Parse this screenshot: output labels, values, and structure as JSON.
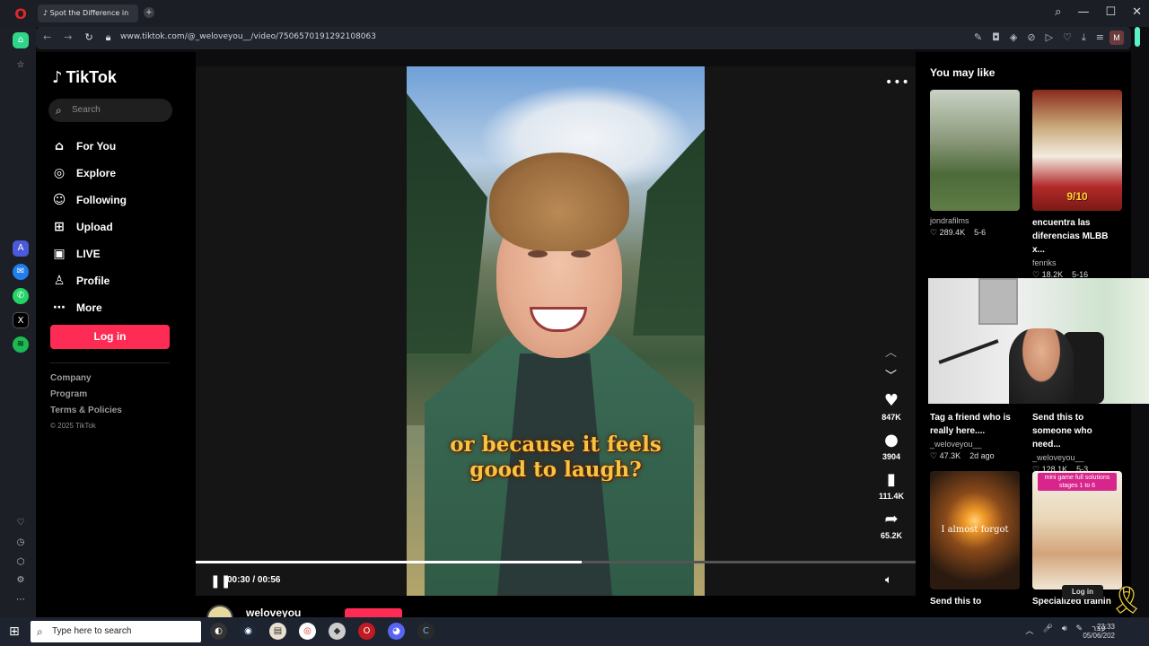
{
  "browser": {
    "tab_title": "Spot the Difference in",
    "new_tab": "+",
    "url": "www.tiktok.com/@_weloveyou__/video/7506570191292108063",
    "profile_initial": "M",
    "window_controls": [
      "⌕",
      "—",
      "☐",
      "✕"
    ]
  },
  "tiktok": {
    "brand": "TikTok",
    "search_placeholder": "Search",
    "nav": [
      {
        "label": "For You",
        "icon": "home-icon"
      },
      {
        "label": "Explore",
        "icon": "compass-icon"
      },
      {
        "label": "Following",
        "icon": "following-icon"
      },
      {
        "label": "Upload",
        "icon": "upload-icon"
      },
      {
        "label": "LIVE",
        "icon": "live-icon"
      },
      {
        "label": "Profile",
        "icon": "profile-icon"
      },
      {
        "label": "More",
        "icon": "more-icon"
      }
    ],
    "login": "Log in",
    "footer": {
      "company": "Company",
      "program": "Program",
      "terms": "Terms & Policies",
      "copyright": "© 2025 TikTok"
    }
  },
  "video": {
    "caption_line1": "or because it feels",
    "caption_line2": "good to laugh?",
    "likes": "847K",
    "comments": "3904",
    "saves": "111.4K",
    "shares": "65.2K",
    "time": "00:30 / 00:56",
    "progress": 0.536,
    "channel_name": "weloveyou"
  },
  "recommendations": {
    "title": "You may like",
    "cards": [
      {
        "title": "",
        "user": "jondrafilms",
        "likes": "289.4K",
        "date": "5-6",
        "thumb": "mountain"
      },
      {
        "title": "encuentra las diferencias MLBB x...",
        "user": "fenriks",
        "likes": "18.2K",
        "date": "5-16",
        "thumb": "game",
        "badge": "9/10"
      },
      {
        "title": "Tag a friend who is really here....",
        "user": "_weloveyou__",
        "likes": "47.3K",
        "date": "2d ago",
        "thumb": "webcam"
      },
      {
        "title": "Send this to someone who need...",
        "user": "_weloveyou__",
        "likes": "128.1K",
        "date": "5-3",
        "thumb": "webcam"
      },
      {
        "title": "Send this to",
        "user": "",
        "likes": "",
        "date": "",
        "thumb": "sunset",
        "overlay": "I almost forgot"
      },
      {
        "title": "Specialized trainin",
        "user": "",
        "likes": "",
        "date": "",
        "thumb": "puzzle",
        "overlay": "mini game full solutions stages 1 to 6"
      }
    ],
    "login_chip": "Log in"
  },
  "taskbar": {
    "search_placeholder": "Type here to search",
    "lang": "עבר",
    "time": "23:33",
    "date": "05/06/202"
  }
}
